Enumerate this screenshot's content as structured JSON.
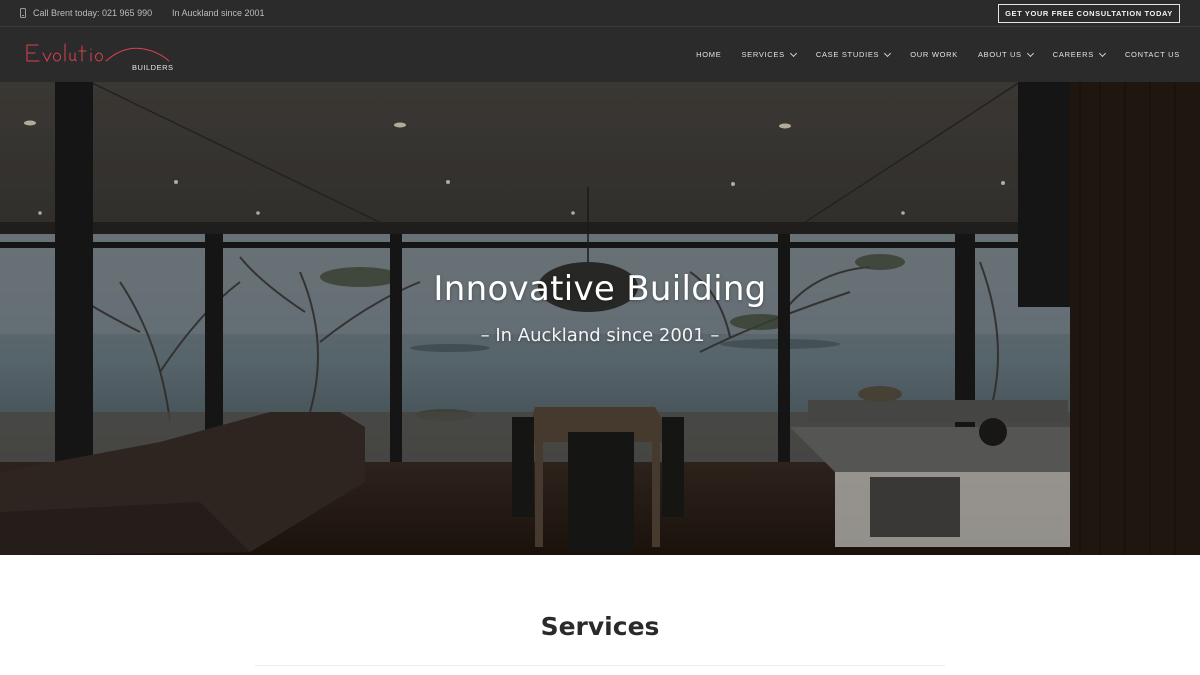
{
  "topbar": {
    "phone_text": "Call Brent today: 021 965 990",
    "since_text": "In Auckland since 2001",
    "cta_label": "GET YOUR FREE CONSULTATION TODAY"
  },
  "logo": {
    "wordmark": "Evolution",
    "sub": "BUILDERS",
    "accent_color": "#d8414f"
  },
  "nav": {
    "items": [
      {
        "label": "HOME",
        "dropdown": false
      },
      {
        "label": "SERVICES",
        "dropdown": true
      },
      {
        "label": "CASE STUDIES",
        "dropdown": true
      },
      {
        "label": "OUR WORK",
        "dropdown": false
      },
      {
        "label": "ABOUT US",
        "dropdown": true
      },
      {
        "label": "CAREERS",
        "dropdown": true
      },
      {
        "label": "CONTACT US",
        "dropdown": false
      }
    ]
  },
  "hero": {
    "title": "Innovative Building",
    "subtitle": "– In Auckland since 2001 –"
  },
  "services": {
    "title": "Services"
  },
  "colors": {
    "header_bg": "#2b2b2b",
    "text_light": "#e2e2e2"
  }
}
